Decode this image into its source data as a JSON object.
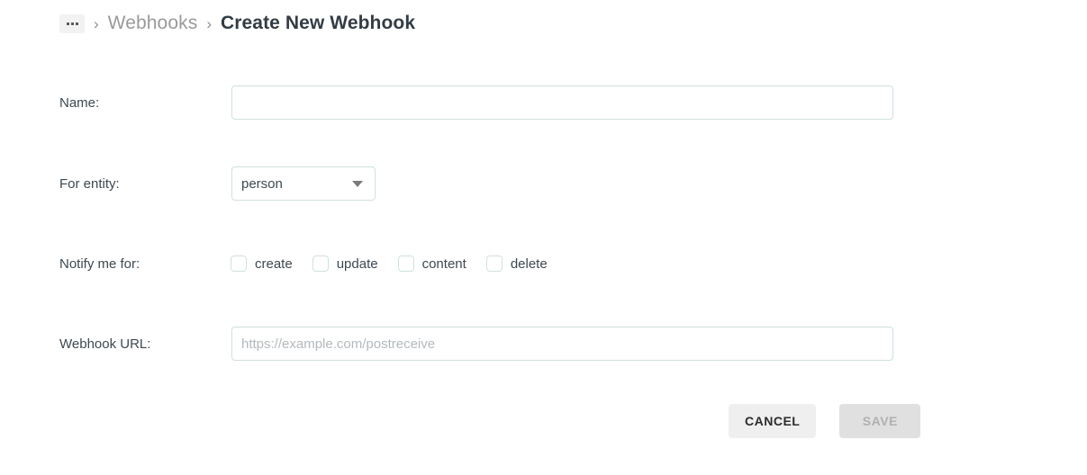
{
  "breadcrumb": {
    "ellipsis_label": "…",
    "separator": "›",
    "parent_label": "Webhooks",
    "current_label": "Create New Webhook"
  },
  "form": {
    "name": {
      "label": "Name:",
      "value": "",
      "placeholder": ""
    },
    "entity": {
      "label": "For entity:",
      "selected": "person"
    },
    "notify": {
      "label": "Notify me for:",
      "options": [
        {
          "label": "create",
          "checked": false
        },
        {
          "label": "update",
          "checked": false
        },
        {
          "label": "content",
          "checked": false
        },
        {
          "label": "delete",
          "checked": false
        }
      ]
    },
    "url": {
      "label": "Webhook URL:",
      "value": "",
      "placeholder": "https://example.com/postreceive"
    }
  },
  "actions": {
    "cancel_label": "CANCEL",
    "save_label": "SAVE",
    "save_disabled": true
  },
  "colors": {
    "input_border": "#cfe1de",
    "text": "#3d4852",
    "muted_text": "#9a9a9a",
    "button_neutral": "#efefef",
    "button_disabled": "#e0e0e0"
  }
}
